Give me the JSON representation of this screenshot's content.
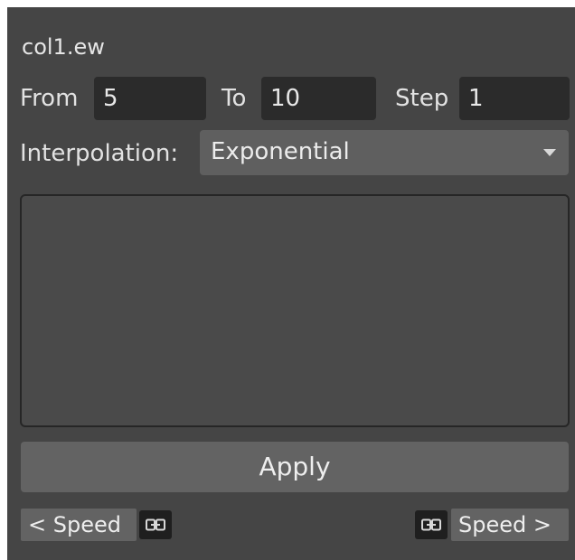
{
  "panel": {
    "title": "col1.ew"
  },
  "range": {
    "from_label": "From",
    "from_value": "5",
    "to_label": "To",
    "to_value": "10",
    "step_label": "Step",
    "step_value": "1"
  },
  "interpolation": {
    "label": "Interpolation:",
    "value": "Exponential"
  },
  "actions": {
    "apply_label": "Apply"
  },
  "speed": {
    "prev_label": "< Speed",
    "next_label": "Speed >",
    "link_icon": "link-icon"
  },
  "colors": {
    "panel_bg": "#454545",
    "field_bg": "#2b2b2b",
    "button_bg": "#636363",
    "text": "#e2e2e2"
  }
}
